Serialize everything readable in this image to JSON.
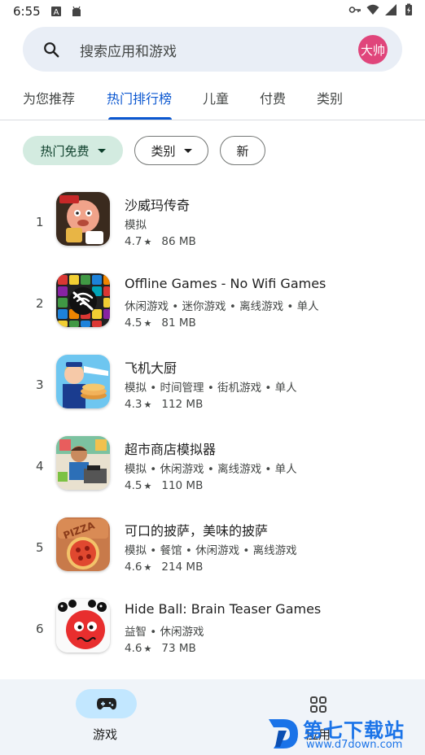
{
  "status_bar": {
    "time": "6:55"
  },
  "search": {
    "placeholder": "搜索应用和游戏",
    "avatar_text": "大帅"
  },
  "tabs": [
    {
      "label": "为您推荐"
    },
    {
      "label": "热门排行榜",
      "active": true
    },
    {
      "label": "儿童"
    },
    {
      "label": "付费"
    },
    {
      "label": "类别"
    }
  ],
  "chips": [
    {
      "label": "热门免费",
      "selected": true
    },
    {
      "label": "类别"
    },
    {
      "label": "新"
    }
  ],
  "apps": [
    {
      "rank": "1",
      "name": "沙威玛传奇",
      "tags": "模拟",
      "rating": "4.7",
      "size": "86 MB"
    },
    {
      "rank": "2",
      "name": "Offline Games - No Wifi Games",
      "tags": "休闲游戏 • 迷你游戏 • 离线游戏 • 单人",
      "rating": "4.5",
      "size": "81 MB"
    },
    {
      "rank": "3",
      "name": "飞机大厨",
      "tags": "模拟 • 时间管理 • 街机游戏 • 单人",
      "rating": "4.3",
      "size": "112 MB"
    },
    {
      "rank": "4",
      "name": "超市商店模拟器",
      "tags": "模拟 • 休闲游戏 • 离线游戏 • 单人",
      "rating": "4.5",
      "size": "110 MB"
    },
    {
      "rank": "5",
      "name": "可口的披萨，美味的披萨",
      "tags": "模拟 • 餐馆 • 休闲游戏 • 离线游戏",
      "rating": "4.6",
      "size": "214 MB"
    },
    {
      "rank": "6",
      "name": "Hide Ball: Brain Teaser Games",
      "tags": "益智 • 休闲游戏",
      "rating": "4.6",
      "size": "73 MB"
    }
  ],
  "bottom_nav": {
    "games_label": "游戏",
    "apps_label": "应用"
  },
  "watermark": {
    "title": "第七下载站",
    "url": "www.d7down.com"
  },
  "colors": {
    "accent": "#0b57d0",
    "chip_selected_bg": "#d3ebe0",
    "avatar_bg": "#e0457b",
    "nav_pill": "#c2e7ff"
  }
}
